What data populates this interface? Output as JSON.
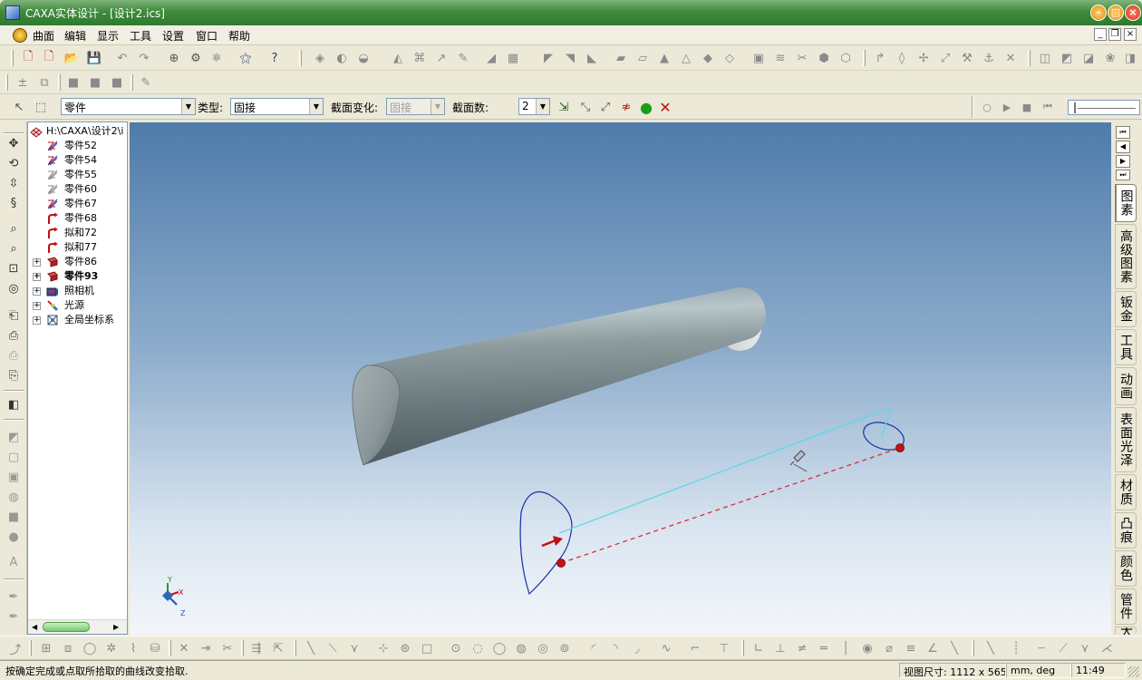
{
  "window": {
    "title": "CAXA实体设计 - [设计2.ics]"
  },
  "menu": {
    "items": [
      "曲面",
      "编辑",
      "显示",
      "工具",
      "设置",
      "窗口",
      "帮助"
    ]
  },
  "propbar": {
    "selector_value": "零件",
    "type_label": "类型:",
    "type_value": "固接",
    "section_change_label": "截面变化:",
    "section_change_value": "固接",
    "section_count_label": "截面数:",
    "section_count_value": "2"
  },
  "tree": {
    "root": "H:\\CAXA\\设计2\\i",
    "items": [
      {
        "label": "零件52",
        "icon": "part-icon",
        "expander": false
      },
      {
        "label": "零件54",
        "icon": "part-icon",
        "expander": false
      },
      {
        "label": "零件55",
        "icon": "part-gray-icon",
        "expander": false
      },
      {
        "label": "零件60",
        "icon": "part-gray-icon",
        "expander": false
      },
      {
        "label": "零件67",
        "icon": "part-icon",
        "expander": false
      },
      {
        "label": "零件68",
        "icon": "curve-icon",
        "expander": false
      },
      {
        "label": "拟和72",
        "icon": "curve-icon",
        "expander": false
      },
      {
        "label": "拟和77",
        "icon": "curve-icon",
        "expander": false
      },
      {
        "label": "零件86",
        "icon": "solid-part-icon",
        "expander": true
      },
      {
        "label": "零件93",
        "icon": "solid-part-icon",
        "expander": true,
        "bold": true
      },
      {
        "label": "照相机",
        "icon": "camera-icon",
        "expander": true
      },
      {
        "label": "光源",
        "icon": "light-icon",
        "expander": true
      },
      {
        "label": "全局坐标系",
        "icon": "axes-icon",
        "expander": true
      }
    ]
  },
  "axes": {
    "x": "X",
    "y": "Y",
    "z": "Z"
  },
  "right_tabs": [
    "图素",
    "高级图素",
    "钣金",
    "工具",
    "动画",
    "表面光泽",
    "材质",
    "凸痕",
    "颜色",
    "管件",
    "大"
  ],
  "status": {
    "message": "按确定完成或点取所拾取的曲线改变拾取.",
    "view_size": "视图尺寸: 1112 x  565",
    "units": "mm, deg",
    "time": "11:49"
  },
  "colors": {
    "title_green": "#3f8a3d",
    "sweep_path": "#5fd8e8",
    "section_curve": "#1a2fa0",
    "guide_line": "#e02020",
    "point_red": "#c81010"
  }
}
